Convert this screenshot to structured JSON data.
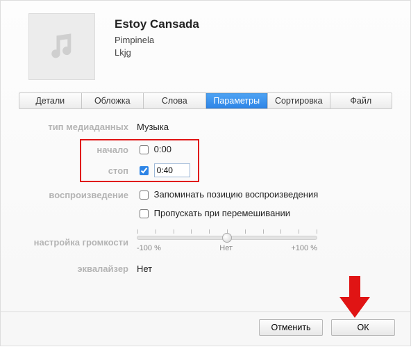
{
  "media": {
    "title": "Estoy Cansada",
    "artist": "Pimpinela",
    "album": "Lkjg"
  },
  "tabs": [
    {
      "label": "Детали"
    },
    {
      "label": "Обложка"
    },
    {
      "label": "Слова"
    },
    {
      "label": "Параметры",
      "active": true
    },
    {
      "label": "Сортировка"
    },
    {
      "label": "Файл"
    }
  ],
  "options": {
    "media_type_label": "тип медиаданных",
    "media_type_value": "Музыка",
    "start_label": "начало",
    "start_checked": false,
    "start_value": "0:00",
    "stop_label": "стоп",
    "stop_checked": true,
    "stop_value": "0:40",
    "playback_label": "воспроизведение",
    "remember_label": "Запоминать позицию воспроизведения",
    "remember_checked": false,
    "skip_shuffle_label": "Пропускать при перемешивании",
    "skip_shuffle_checked": false,
    "volume_label": "настройка громкости",
    "slider": {
      "min_label": "-100 %",
      "mid_label": "Нет",
      "max_label": "+100 %"
    },
    "equalizer_label": "эквалайзер",
    "equalizer_value": "Нет"
  },
  "footer": {
    "cancel": "Отменить",
    "ok": "ОК"
  }
}
